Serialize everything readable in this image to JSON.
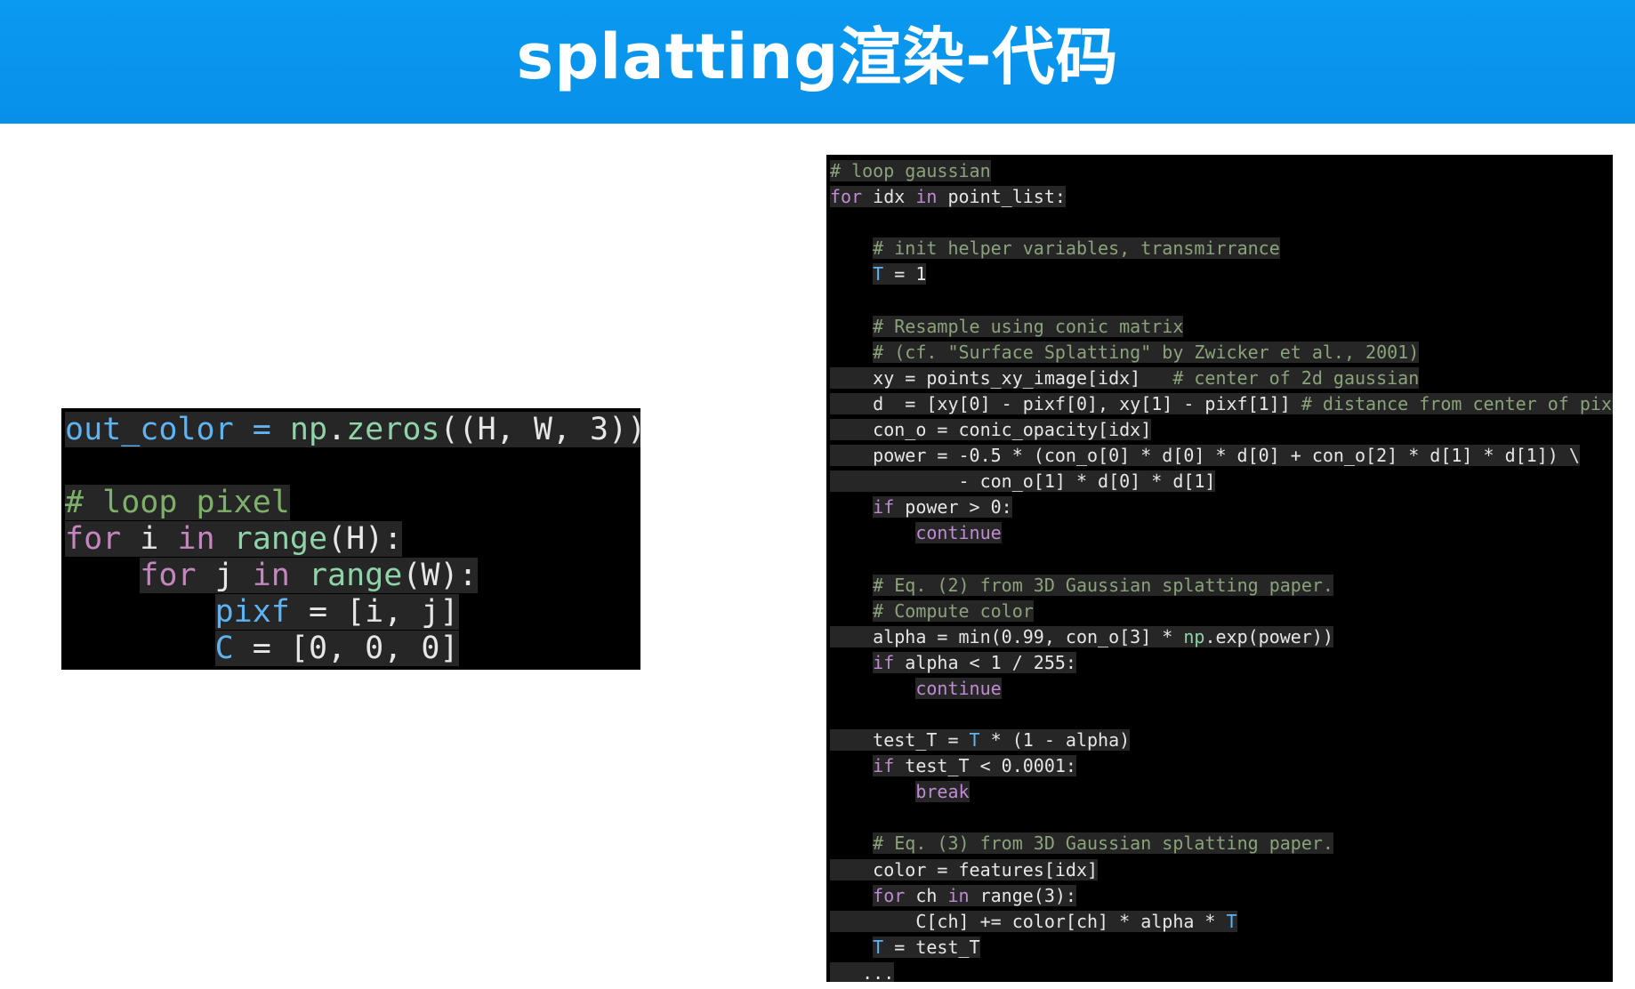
{
  "title": "splatting渲染-代码",
  "left_code": {
    "lines": [
      [
        {
          "t": "out_color = ",
          "c": "c-var"
        },
        {
          "t": "np",
          "c": "c-fn"
        },
        {
          "t": ".",
          "c": "c-txt"
        },
        {
          "t": "zeros",
          "c": "c-fn"
        },
        {
          "t": "((H, W, 3))",
          "c": "c-txt"
        }
      ],
      [],
      [
        {
          "t": "# loop pixel",
          "c": "c-cmt"
        }
      ],
      [
        {
          "t": "for",
          "c": "c-kw"
        },
        {
          "t": " i ",
          "c": "c-txt"
        },
        {
          "t": "in",
          "c": "c-kw"
        },
        {
          "t": " ",
          "c": "c-txt"
        },
        {
          "t": "range",
          "c": "c-fn"
        },
        {
          "t": "(H):",
          "c": "c-txt"
        }
      ],
      [
        {
          "t": "    ",
          "c": "c-txt"
        },
        {
          "t": "for",
          "c": "c-kw"
        },
        {
          "t": " j ",
          "c": "c-txt"
        },
        {
          "t": "in",
          "c": "c-kw"
        },
        {
          "t": " ",
          "c": "c-txt"
        },
        {
          "t": "range",
          "c": "c-fn"
        },
        {
          "t": "(W):",
          "c": "c-txt"
        }
      ],
      [
        {
          "t": "        ",
          "c": "c-txt"
        },
        {
          "t": "pixf",
          "c": "c-var"
        },
        {
          "t": " = [i, j]",
          "c": "c-txt"
        }
      ],
      [
        {
          "t": "        ",
          "c": "c-txt"
        },
        {
          "t": "C",
          "c": "c-var"
        },
        {
          "t": " = [0, 0, 0]",
          "c": "c-txt"
        }
      ]
    ]
  },
  "right_code": {
    "lines": [
      [
        {
          "t": "# loop gaussian",
          "c": "c-cmtr"
        }
      ],
      [
        {
          "t": "for",
          "c": "c-kwr"
        },
        {
          "t": " idx ",
          "c": "c-txt"
        },
        {
          "t": "in",
          "c": "c-kwr"
        },
        {
          "t": " point_list:",
          "c": "c-txt"
        }
      ],
      [],
      [
        {
          "t": "    ",
          "c": "c-txt"
        },
        {
          "t": "# init helper variables, transmirrance",
          "c": "c-cmtr"
        }
      ],
      [
        {
          "t": "    ",
          "c": "c-txt"
        },
        {
          "t": "T",
          "c": "c-var"
        },
        {
          "t": " = 1",
          "c": "c-txt"
        }
      ],
      [],
      [
        {
          "t": "    ",
          "c": "c-txt"
        },
        {
          "t": "# Resample using conic matrix",
          "c": "c-cmtr"
        }
      ],
      [
        {
          "t": "    ",
          "c": "c-txt"
        },
        {
          "t": "# (cf. \"Surface Splatting\" by Zwicker et al., 2001)",
          "c": "c-cmtr"
        }
      ],
      [
        {
          "t": "    xy = points_xy_image[idx]   ",
          "c": "c-txt"
        },
        {
          "t": "# center of 2d gaussian",
          "c": "c-cmtr"
        }
      ],
      [
        {
          "t": "    d  = [xy[0] - pixf[0], xy[1] - pixf[1]] ",
          "c": "c-txt"
        },
        {
          "t": "# distance from center of pixel",
          "c": "c-cmtr"
        }
      ],
      [
        {
          "t": "    con_o = conic_opacity[idx]",
          "c": "c-txt"
        }
      ],
      [
        {
          "t": "    power = -0.5 * (con_o[0] * d[0] * d[0] + con_o[2] * d[1] * d[1]) \\",
          "c": "c-txt"
        }
      ],
      [
        {
          "t": "            - con_o[1] * d[0] * d[1]",
          "c": "c-txt"
        }
      ],
      [
        {
          "t": "    ",
          "c": "c-txt"
        },
        {
          "t": "if",
          "c": "c-kwr"
        },
        {
          "t": " power > 0:",
          "c": "c-txt"
        }
      ],
      [
        {
          "t": "        ",
          "c": "c-txt"
        },
        {
          "t": "continue",
          "c": "c-kwr"
        }
      ],
      [],
      [
        {
          "t": "    ",
          "c": "c-txt"
        },
        {
          "t": "# Eq. (2) from 3D Gaussian splatting paper.",
          "c": "c-cmtr"
        }
      ],
      [
        {
          "t": "    ",
          "c": "c-txt"
        },
        {
          "t": "# Compute color",
          "c": "c-cmtr"
        }
      ],
      [
        {
          "t": "    alpha = min(0.99, con_o[3] * ",
          "c": "c-txt"
        },
        {
          "t": "np",
          "c": "c-fn"
        },
        {
          "t": ".exp(power))",
          "c": "c-txt"
        }
      ],
      [
        {
          "t": "    ",
          "c": "c-txt"
        },
        {
          "t": "if",
          "c": "c-kwr"
        },
        {
          "t": " alpha < 1 / 255:",
          "c": "c-txt"
        }
      ],
      [
        {
          "t": "        ",
          "c": "c-txt"
        },
        {
          "t": "continue",
          "c": "c-kwr"
        }
      ],
      [],
      [
        {
          "t": "    test_T = ",
          "c": "c-txt"
        },
        {
          "t": "T",
          "c": "c-var"
        },
        {
          "t": " * (1 - alpha)",
          "c": "c-txt"
        }
      ],
      [
        {
          "t": "    ",
          "c": "c-txt"
        },
        {
          "t": "if",
          "c": "c-kwr"
        },
        {
          "t": " test_T < 0.0001:",
          "c": "c-txt"
        }
      ],
      [
        {
          "t": "        ",
          "c": "c-txt"
        },
        {
          "t": "break",
          "c": "c-kwr"
        }
      ],
      [],
      [
        {
          "t": "    ",
          "c": "c-txt"
        },
        {
          "t": "# Eq. (3) from 3D Gaussian splatting paper.",
          "c": "c-cmtr"
        }
      ],
      [
        {
          "t": "    color = features[idx]",
          "c": "c-txt"
        }
      ],
      [
        {
          "t": "    ",
          "c": "c-txt"
        },
        {
          "t": "for",
          "c": "c-kwr"
        },
        {
          "t": " ch ",
          "c": "c-txt"
        },
        {
          "t": "in",
          "c": "c-kwr"
        },
        {
          "t": " range(3):",
          "c": "c-txt"
        }
      ],
      [
        {
          "t": "        C[ch] += color[ch] * alpha * ",
          "c": "c-txt"
        },
        {
          "t": "T",
          "c": "c-var"
        }
      ],
      [
        {
          "t": "    ",
          "c": "c-txt"
        },
        {
          "t": "T",
          "c": "c-var"
        },
        {
          "t": " = test_T",
          "c": "c-txt"
        }
      ],
      [
        {
          "t": "   ...",
          "c": "c-txt"
        }
      ]
    ]
  },
  "colors": {
    "header": "#0a9af0",
    "code_background": "#000000"
  }
}
